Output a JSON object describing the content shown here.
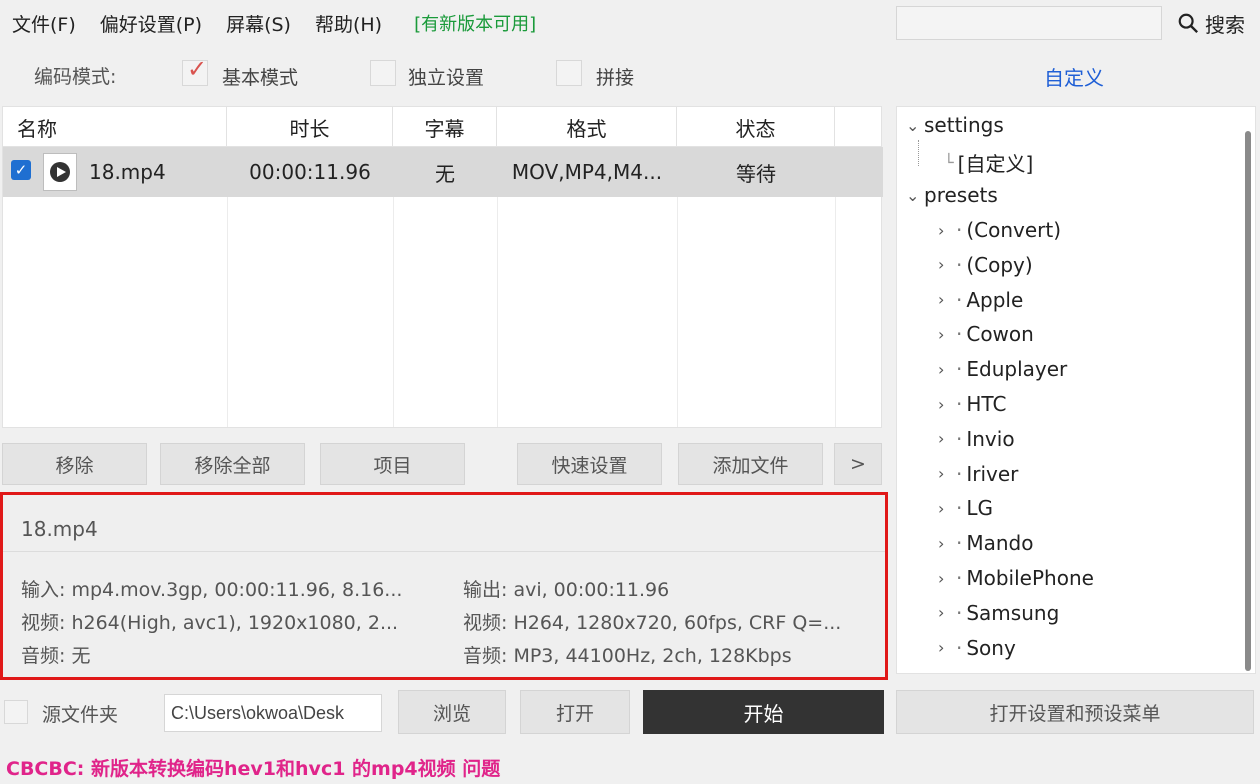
{
  "menu": {
    "file": "文件(F)",
    "prefs": "偏好设置(P)",
    "screen": "屏幕(S)",
    "help": "帮助(H)",
    "update": "[有新版本可用]"
  },
  "search": {
    "value": "",
    "label": "搜索"
  },
  "mode": {
    "label": "编码模式:",
    "basic": {
      "label": "基本模式",
      "checked": true
    },
    "independent": {
      "label": "独立设置",
      "checked": false
    },
    "join": {
      "label": "拼接",
      "checked": false
    },
    "custom_link": "自定义"
  },
  "table": {
    "columns": [
      "名称",
      "时长",
      "字幕",
      "格式",
      "状态"
    ],
    "rows": [
      {
        "checked": true,
        "name": "18.mp4",
        "duration": "00:00:11.96",
        "subtitle": "无",
        "format": "MOV,MP4,M4...",
        "status": "等待"
      }
    ]
  },
  "buttons": {
    "remove": "移除",
    "remove_all": "移除全部",
    "item": "项目",
    "quick_settings": "快速设置",
    "add_file": "添加文件",
    "more": ">"
  },
  "info": {
    "filename": "18.mp4",
    "input": "输入: mp4.mov.3gp, 00:00:11.96, 8.16...",
    "input_video": "视频: h264(High, avc1), 1920x1080, 2...",
    "input_audio": "音频: 无",
    "output": "输出: avi, 00:00:11.96",
    "output_video": "视频: H264, 1280x720, 60fps, CRF Q=...",
    "output_audio": "音频: MP3, 44100Hz, 2ch, 128Kbps"
  },
  "bottom": {
    "source_folder": "源文件夹",
    "path": "C:\\Users\\okwoa\\Desk",
    "browse": "浏览",
    "open": "打开",
    "start": "开始",
    "open_settings": "打开设置和预设菜单"
  },
  "tree": {
    "settings": "settings",
    "custom": "[自定义]",
    "presets": "presets",
    "items": [
      "(Convert)",
      "(Copy)",
      "Apple",
      "Cowon",
      "Eduplayer",
      "HTC",
      "Invio",
      "Iriver",
      "LG",
      "Mando",
      "MobilePhone",
      "Samsung",
      "Sony"
    ]
  },
  "status_message": "CBCBC: 新版本转换编码hev1和hvc1 的mp4视频 问题",
  "colors": {
    "update": "#1a9a3a",
    "link": "#1f5fd6",
    "highlight_border": "#e01818",
    "status": "#e0248a",
    "start_bg": "#333333"
  }
}
